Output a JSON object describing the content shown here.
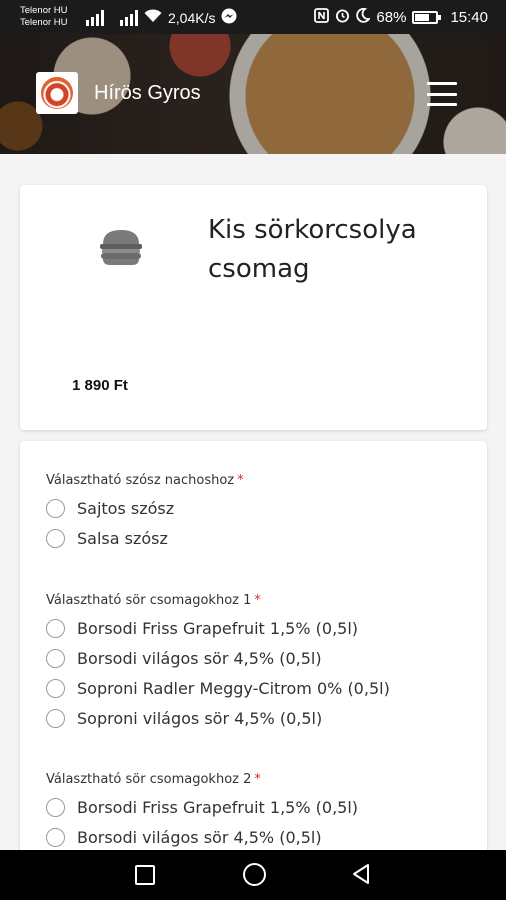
{
  "status_bar": {
    "carrier1": "Telenor HU",
    "carrier2": "Telenor HU",
    "net_speed": "2,04K/s",
    "battery": "68%",
    "battery_level": 0.68,
    "time": "15:40"
  },
  "header": {
    "title": "Hírös Gyros"
  },
  "product": {
    "name": "Kis sörkorcsolya csomag",
    "price": "1 890 Ft"
  },
  "option_groups": [
    {
      "title": "Választható szósz nachoshoz",
      "required_mark": "*",
      "options": [
        "Sajtos szósz",
        "Salsa szósz"
      ]
    },
    {
      "title": "Választható sör csomagokhoz 1",
      "required_mark": "*",
      "options": [
        "Borsodi Friss Grapefruit 1,5% (0,5l)",
        "Borsodi világos sör 4,5% (0,5l)",
        "Soproni Radler Meggy-Citrom 0% (0,5l)",
        "Soproni világos sör 4,5% (0,5l)"
      ]
    },
    {
      "title": "Választható sör csomagokhoz 2",
      "required_mark": "*",
      "options": [
        "Borsodi Friss Grapefruit 1,5% (0,5l)",
        "Borsodi világos sör 4,5% (0,5l)"
      ]
    }
  ],
  "colors": {
    "required": "#d32f2f",
    "status_bar": "#1b1b1b",
    "nav_bar": "#000000"
  }
}
